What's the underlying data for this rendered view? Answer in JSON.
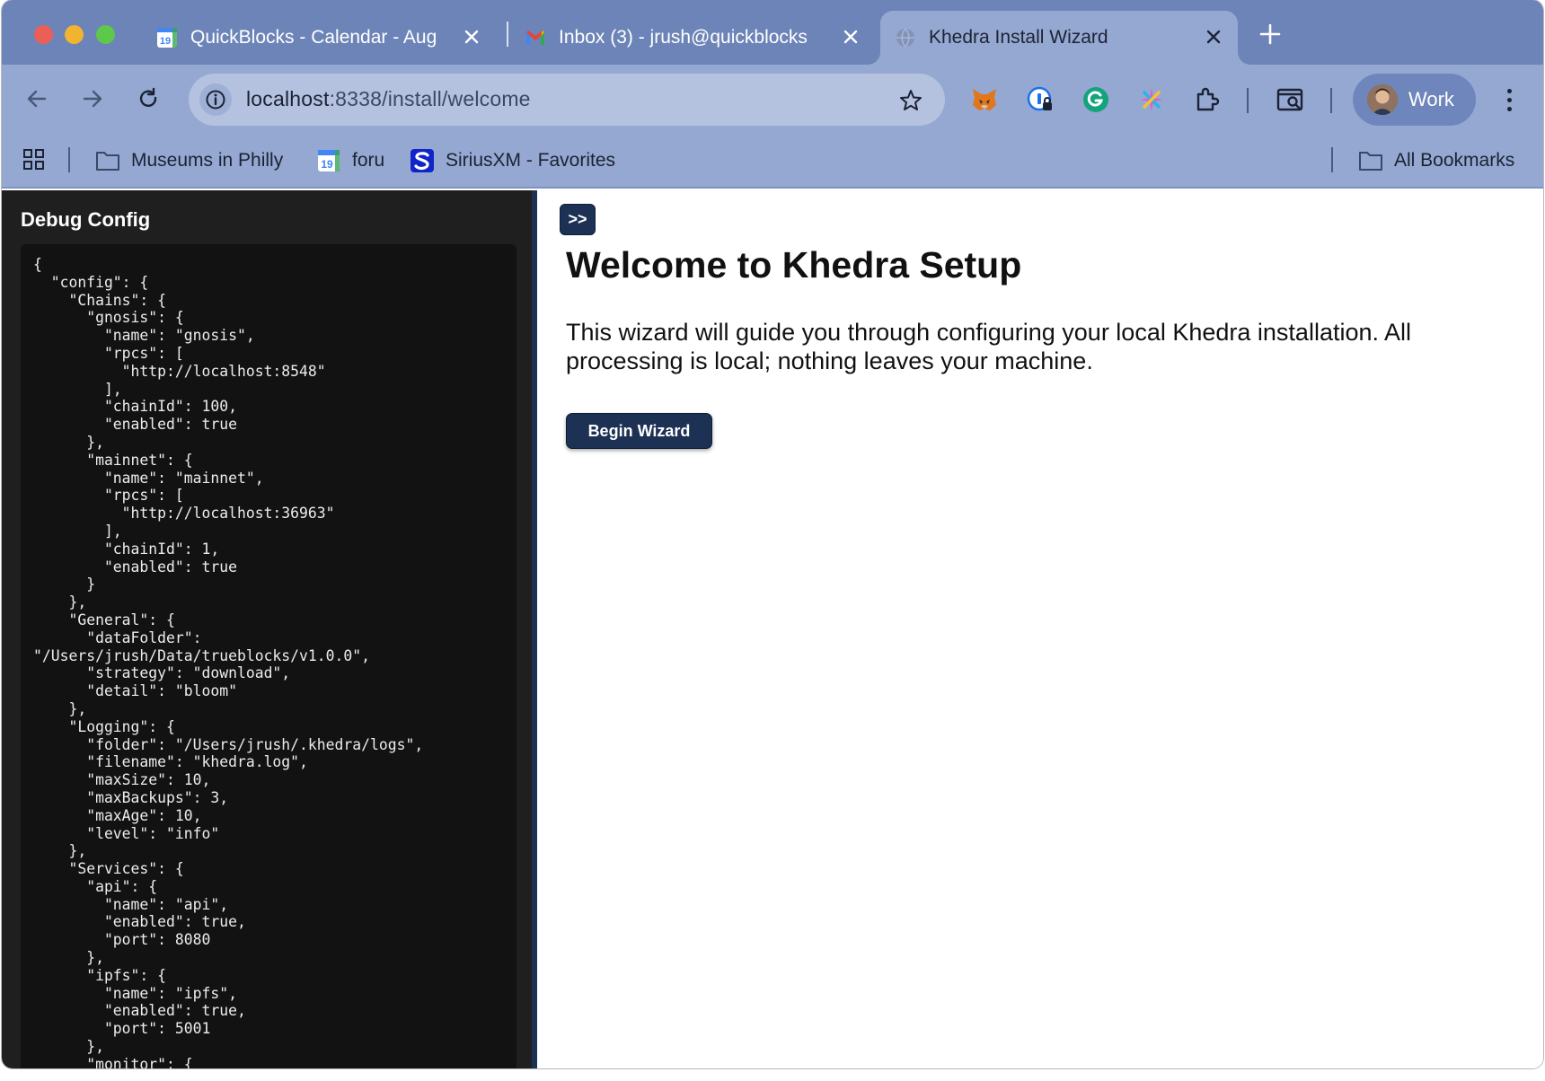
{
  "browser": {
    "tabs": [
      {
        "title": "QuickBlocks - Calendar - Aug",
        "favicon": "calendar-icon",
        "active": false
      },
      {
        "title": "Inbox (3) - jrush@quickblocks",
        "favicon": "gmail-icon",
        "active": false
      },
      {
        "title": "Khedra Install Wizard",
        "favicon": "globe-icon",
        "active": true
      }
    ],
    "url_host": "localhost",
    "url_rest": ":8338/install/welcome",
    "profile_label": "Work",
    "bookmarks": [
      {
        "label": "Museums in Philly",
        "icon": "folder-icon"
      },
      {
        "label": "foru",
        "icon": "calendar-icon"
      },
      {
        "label": "SiriusXM - Favorites",
        "icon": "siriusxm-icon"
      }
    ],
    "all_bookmarks_label": "All Bookmarks",
    "extensions": [
      "metamask-icon",
      "password-manager-icon",
      "grammarly-icon",
      "sparkle-icon",
      "puzzle-icon"
    ]
  },
  "debug": {
    "title": "Debug Config",
    "config_text": "{\n  \"config\": {\n    \"Chains\": {\n      \"gnosis\": {\n        \"name\": \"gnosis\",\n        \"rpcs\": [\n          \"http://localhost:8548\"\n        ],\n        \"chainId\": 100,\n        \"enabled\": true\n      },\n      \"mainnet\": {\n        \"name\": \"mainnet\",\n        \"rpcs\": [\n          \"http://localhost:36963\"\n        ],\n        \"chainId\": 1,\n        \"enabled\": true\n      }\n    },\n    \"General\": {\n      \"dataFolder\":\n\"/Users/jrush/Data/trueblocks/v1.0.0\",\n      \"strategy\": \"download\",\n      \"detail\": \"bloom\"\n    },\n    \"Logging\": {\n      \"folder\": \"/Users/jrush/.khedra/logs\",\n      \"filename\": \"khedra.log\",\n      \"maxSize\": 10,\n      \"maxBackups\": 3,\n      \"maxAge\": 10,\n      \"level\": \"info\"\n    },\n    \"Services\": {\n      \"api\": {\n        \"name\": \"api\",\n        \"enabled\": true,\n        \"port\": 8080\n      },\n      \"ipfs\": {\n        \"name\": \"ipfs\",\n        \"enabled\": true,\n        \"port\": 5001\n      },\n      \"monitor\": {"
  },
  "main": {
    "toggle_label": ">>",
    "title": "Welcome to Khedra Setup",
    "description": "This wizard will guide you through configuring your local Khedra installation. All processing is local; nothing leaves your machine.",
    "begin_button": "Begin Wizard"
  },
  "colors": {
    "tabstrip": "#6c84b7",
    "toolbar": "#94a8d2",
    "accent": "#1c3154",
    "debug_bg": "#1f1f1f"
  }
}
